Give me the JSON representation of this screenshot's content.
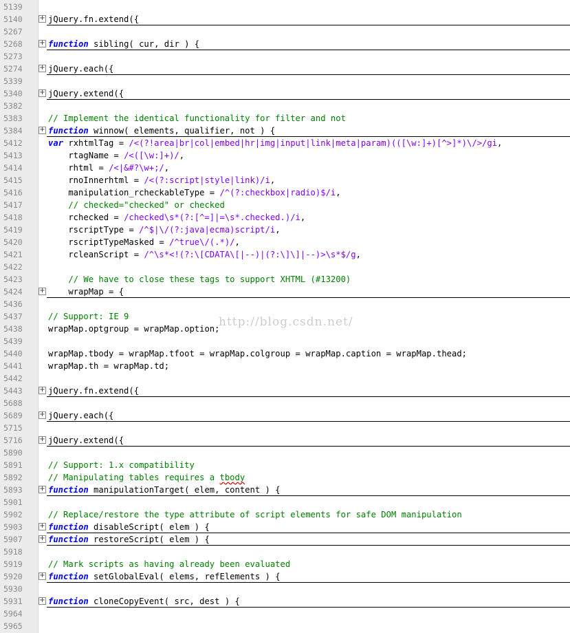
{
  "editor": {
    "watermark": "http://blog.csdn.net/",
    "lines": [
      {
        "num": "5139",
        "code": ""
      },
      {
        "num": "5140",
        "fold": "+",
        "collapsed": true,
        "code": "jQuery.fn.extend({"
      },
      {
        "num": "5267",
        "code": ""
      },
      {
        "num": "5268",
        "fold": "+",
        "collapsed": true,
        "segments": [
          {
            "t": "function",
            "c": "kw"
          },
          {
            "t": " sibling( cur, dir ) {"
          }
        ]
      },
      {
        "num": "5273",
        "code": ""
      },
      {
        "num": "5274",
        "fold": "+",
        "collapsed": true,
        "code": "jQuery.each({"
      },
      {
        "num": "5339",
        "code": ""
      },
      {
        "num": "5340",
        "fold": "+",
        "collapsed": true,
        "code": "jQuery.extend({"
      },
      {
        "num": "5382",
        "code": ""
      },
      {
        "num": "5383",
        "segments": [
          {
            "t": "// Implement the identical functionality for filter and not",
            "c": "cm"
          }
        ]
      },
      {
        "num": "5384",
        "fold": "+",
        "collapsed": true,
        "segments": [
          {
            "t": "function",
            "c": "kw"
          },
          {
            "t": " winnow( elements, qualifier, not ) {"
          }
        ]
      },
      {
        "num": "5412",
        "segments": [
          {
            "t": "var",
            "c": "kw"
          },
          {
            "t": " rxhtmlTag = "
          },
          {
            "t": "/<(?!area|br|col|embed|hr|img|input|link|meta|param)(([\\w:]+)[^>]*)\\/>/gi",
            "c": "rx"
          },
          {
            "t": ","
          }
        ]
      },
      {
        "num": "5413",
        "segments": [
          {
            "t": "    rtagName = "
          },
          {
            "t": "/<([\\w:]+)/",
            "c": "rx"
          },
          {
            "t": ","
          }
        ]
      },
      {
        "num": "5414",
        "segments": [
          {
            "t": "    rhtml = "
          },
          {
            "t": "/<|&#?\\w+;/",
            "c": "rx"
          },
          {
            "t": ","
          }
        ]
      },
      {
        "num": "5415",
        "segments": [
          {
            "t": "    rnoInnerhtml = "
          },
          {
            "t": "/<(?:script|style|link)/i",
            "c": "rx"
          },
          {
            "t": ","
          }
        ]
      },
      {
        "num": "5416",
        "segments": [
          {
            "t": "    manipulation_rcheckableType = "
          },
          {
            "t": "/^(?:checkbox|radio)$/i",
            "c": "rx"
          },
          {
            "t": ","
          }
        ]
      },
      {
        "num": "5417",
        "segments": [
          {
            "t": "    "
          },
          {
            "t": "// checked=\"checked\" or checked",
            "c": "cm"
          }
        ]
      },
      {
        "num": "5418",
        "segments": [
          {
            "t": "    rchecked = "
          },
          {
            "t": "/checked\\s*(?:[^=]|=\\s*.checked.)/i",
            "c": "rx"
          },
          {
            "t": ","
          }
        ]
      },
      {
        "num": "5419",
        "segments": [
          {
            "t": "    rscriptType = "
          },
          {
            "t": "/^$|\\/(?:java|ecma)script/i",
            "c": "rx"
          },
          {
            "t": ","
          }
        ]
      },
      {
        "num": "5420",
        "segments": [
          {
            "t": "    rscriptTypeMasked = "
          },
          {
            "t": "/^true\\/(.*)/",
            "c": "rx"
          },
          {
            "t": ","
          }
        ]
      },
      {
        "num": "5421",
        "segments": [
          {
            "t": "    rcleanScript = "
          },
          {
            "t": "/^\\s*<!(?:\\[CDATA\\[|--)|(?:\\]\\]|--)>\\s*$/g",
            "c": "rx"
          },
          {
            "t": ","
          }
        ]
      },
      {
        "num": "5422",
        "code": ""
      },
      {
        "num": "5423",
        "segments": [
          {
            "t": "    "
          },
          {
            "t": "// We have to close these tags to support XHTML (#13200)",
            "c": "cm"
          }
        ]
      },
      {
        "num": "5424",
        "fold": "+",
        "collapsed": true,
        "code": "    wrapMap = {"
      },
      {
        "num": "5436",
        "code": ""
      },
      {
        "num": "5437",
        "segments": [
          {
            "t": "// Support: IE 9",
            "c": "cm"
          }
        ]
      },
      {
        "num": "5438",
        "code": "wrapMap.optgroup = wrapMap.option;"
      },
      {
        "num": "5439",
        "code": ""
      },
      {
        "num": "5440",
        "code": "wrapMap.tbody = wrapMap.tfoot = wrapMap.colgroup = wrapMap.caption = wrapMap.thead;"
      },
      {
        "num": "5441",
        "code": "wrapMap.th = wrapMap.td;"
      },
      {
        "num": "5442",
        "code": ""
      },
      {
        "num": "5443",
        "fold": "+",
        "collapsed": true,
        "code": "jQuery.fn.extend({"
      },
      {
        "num": "5688",
        "code": ""
      },
      {
        "num": "5689",
        "fold": "+",
        "collapsed": true,
        "code": "jQuery.each({"
      },
      {
        "num": "5715",
        "code": ""
      },
      {
        "num": "5716",
        "fold": "+",
        "collapsed": true,
        "code": "jQuery.extend({"
      },
      {
        "num": "5890",
        "code": ""
      },
      {
        "num": "5891",
        "segments": [
          {
            "t": "// Support: 1.x compatibility",
            "c": "cm"
          }
        ]
      },
      {
        "num": "5892",
        "segments": [
          {
            "t": "// Manipulating tables requires a ",
            "c": "cm"
          },
          {
            "t": "tbody",
            "c": "cm sq"
          }
        ]
      },
      {
        "num": "5893",
        "fold": "+",
        "collapsed": true,
        "segments": [
          {
            "t": "function",
            "c": "kw"
          },
          {
            "t": " manipulationTarget( elem, content ) {"
          }
        ]
      },
      {
        "num": "5901",
        "code": ""
      },
      {
        "num": "5902",
        "segments": [
          {
            "t": "// Replace/restore the type attribute of script elements for safe DOM manipulation",
            "c": "cm"
          }
        ]
      },
      {
        "num": "5903",
        "fold": "+",
        "collapsed": true,
        "segments": [
          {
            "t": "function",
            "c": "kw"
          },
          {
            "t": " disableScript( elem ) {"
          }
        ]
      },
      {
        "num": "5907",
        "fold": "+",
        "collapsed": true,
        "segments": [
          {
            "t": "function",
            "c": "kw"
          },
          {
            "t": " restoreScript( elem ) {"
          }
        ]
      },
      {
        "num": "5918",
        "code": ""
      },
      {
        "num": "5919",
        "segments": [
          {
            "t": "// Mark scripts as having already been evaluated",
            "c": "cm"
          }
        ]
      },
      {
        "num": "5920",
        "fold": "+",
        "collapsed": true,
        "segments": [
          {
            "t": "function",
            "c": "kw"
          },
          {
            "t": " setGlobalEval( elems, refElements ) {"
          }
        ]
      },
      {
        "num": "5930",
        "code": ""
      },
      {
        "num": "5931",
        "fold": "+",
        "collapsed": true,
        "segments": [
          {
            "t": "function",
            "c": "kw"
          },
          {
            "t": " cloneCopyEvent( src, dest ) {"
          }
        ]
      },
      {
        "num": "5964",
        "code": ""
      },
      {
        "num": "5965",
        "code": ""
      }
    ]
  }
}
